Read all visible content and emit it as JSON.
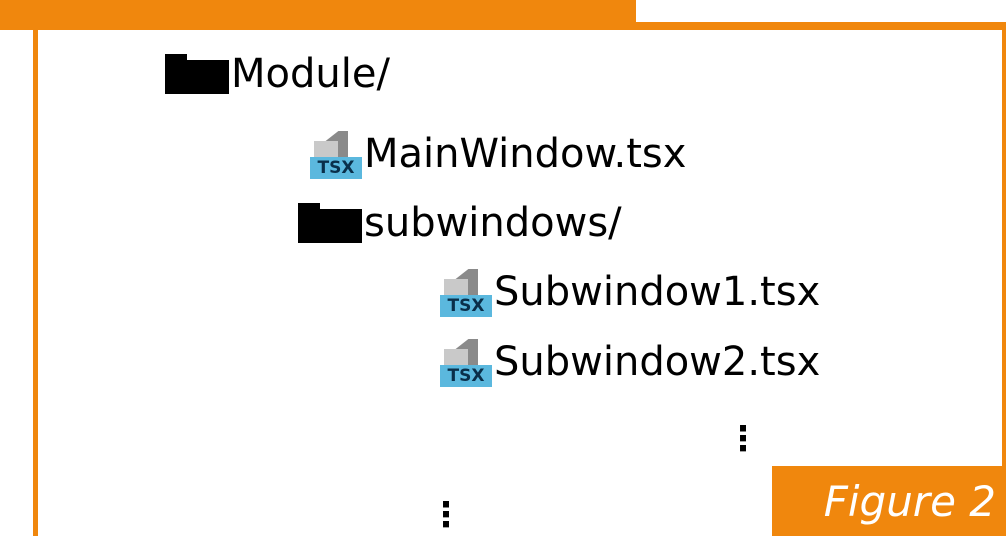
{
  "colors": {
    "accent": "#f0870d",
    "tsx_badge": "#5bb8de",
    "text": "#000000"
  },
  "tree": {
    "root": {
      "label": "Module/",
      "icon": "folder-icon"
    },
    "main_window": {
      "label": "MainWindow.tsx",
      "icon": "tsx-file-icon",
      "badge": "TSX"
    },
    "subwindows": {
      "label": "subwindows/",
      "icon": "folder-icon"
    },
    "subwindow1": {
      "label": "Subwindow1.tsx",
      "icon": "tsx-file-icon",
      "badge": "TSX"
    },
    "subwindow2": {
      "label": "Subwindow2.tsx",
      "icon": "tsx-file-icon",
      "badge": "TSX"
    },
    "inner_ellipsis": "⋮",
    "outer_ellipsis": "⋮"
  },
  "figure": {
    "label": "Figure 2"
  }
}
